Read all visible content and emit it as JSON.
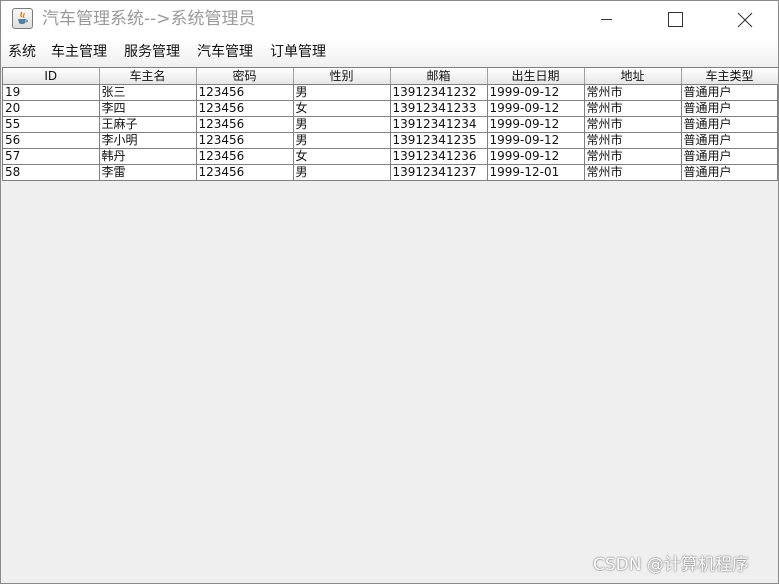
{
  "window": {
    "title": "汽车管理系统-->系统管理员",
    "icon": "java-icon",
    "controls": [
      "minimize",
      "maximize",
      "close"
    ]
  },
  "menu": [
    "系统",
    "车主管理",
    "服务管理",
    "汽车管理",
    "订单管理"
  ],
  "table": {
    "columns": [
      "ID",
      "车主名",
      "密码",
      "性别",
      "邮箱",
      "出生日期",
      "地址",
      "车主类型"
    ],
    "rows": [
      [
        "19",
        "张三",
        "123456",
        "男",
        "13912341232",
        "1999-09-12",
        "常州市",
        "普通用户"
      ],
      [
        "20",
        "李四",
        "123456",
        "女",
        "13912341233",
        "1999-09-12",
        "常州市",
        "普通用户"
      ],
      [
        "55",
        "王麻子",
        "123456",
        "男",
        "13912341234",
        "1999-09-12",
        "常州市",
        "普通用户"
      ],
      [
        "56",
        "李小明",
        "123456",
        "男",
        "13912341235",
        "1999-09-12",
        "常州市",
        "普通用户"
      ],
      [
        "57",
        "韩丹",
        "123456",
        "女",
        "13912341236",
        "1999-09-12",
        "常州市",
        "普通用户"
      ],
      [
        "58",
        "李雷",
        "123456",
        "男",
        "13912341237",
        "1999-12-01",
        "常州市",
        "普通用户"
      ]
    ]
  },
  "watermark": "CSDN @计算机程序"
}
